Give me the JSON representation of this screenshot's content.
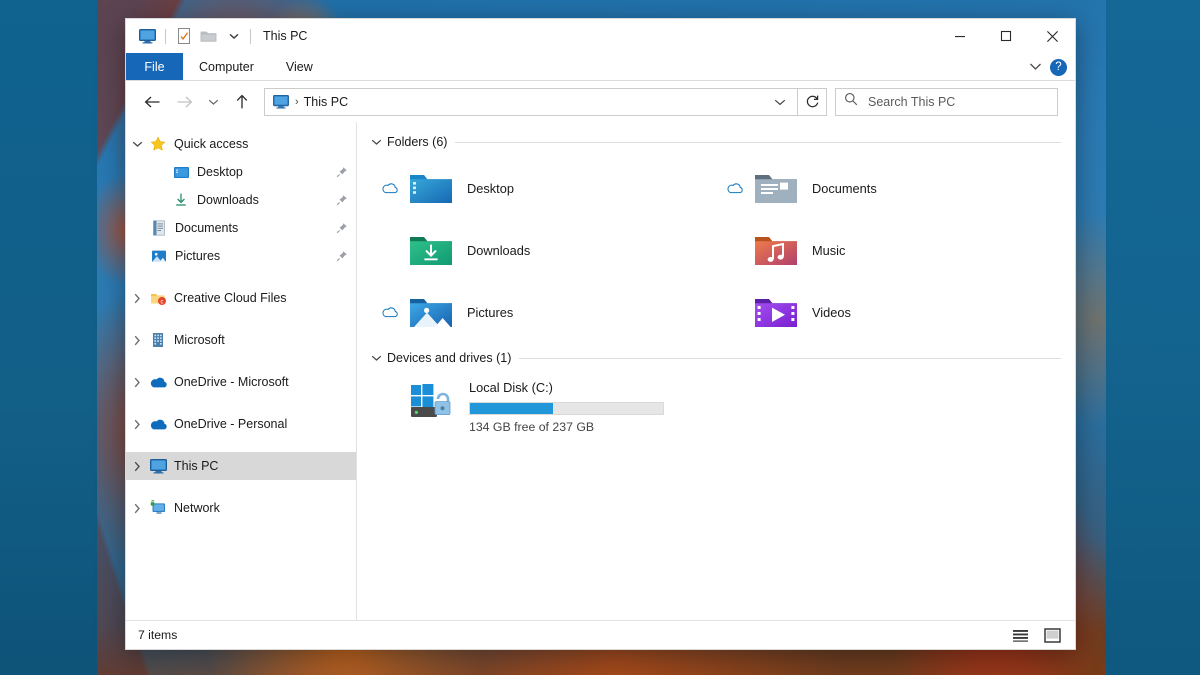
{
  "window": {
    "title": "This PC",
    "quick_access_toolbar": [
      {
        "name": "this-pc-icon",
        "label": "This PC"
      },
      {
        "name": "properties-icon",
        "label": "Properties"
      },
      {
        "name": "new-folder-icon",
        "label": "New folder"
      },
      {
        "name": "customize-dropdown-icon",
        "label": "Customize Quick Access Toolbar"
      }
    ],
    "controls": {
      "minimize": "─",
      "maximize": "☐",
      "close": "✕"
    }
  },
  "ribbon": {
    "tabs": [
      {
        "label": "File",
        "active": true
      },
      {
        "label": "Computer",
        "active": false
      },
      {
        "label": "View",
        "active": false
      }
    ],
    "expand_label": "Expand the Ribbon",
    "help_label": "?"
  },
  "navbar": {
    "back_label": "Back",
    "forward_label": "Forward",
    "recent_label": "Recent locations",
    "up_label": "Up to Desktop",
    "breadcrumb": {
      "icon": "this-pc-icon",
      "separator": "›",
      "text": "This PC"
    },
    "address_dropdown_label": "Previous locations",
    "refresh_label": "Refresh This PC",
    "search": {
      "placeholder": "Search This PC",
      "value": ""
    }
  },
  "sidebar": {
    "items": [
      {
        "label": "Quick access",
        "icon": "star-icon",
        "expanded": true,
        "chevron": "down",
        "indent": 0,
        "pinned": false,
        "selected": false
      },
      {
        "label": "Desktop",
        "icon": "desktop-folder-icon",
        "chevron": "none",
        "indent": 1,
        "pinned": true,
        "selected": false
      },
      {
        "label": "Downloads",
        "icon": "downloads-icon",
        "chevron": "none",
        "indent": 1,
        "pinned": true,
        "selected": false
      },
      {
        "label": "Documents",
        "icon": "documents-icon",
        "chevron": "none",
        "indent": 1,
        "pinned": true,
        "selected": false
      },
      {
        "label": "Pictures",
        "icon": "pictures-icon",
        "chevron": "none",
        "indent": 1,
        "pinned": true,
        "selected": false
      },
      {
        "label": "Creative Cloud Files",
        "icon": "creative-cloud-icon",
        "chevron": "right",
        "indent": 0,
        "pinned": false,
        "selected": false
      },
      {
        "label": "Microsoft",
        "icon": "building-icon",
        "chevron": "right",
        "indent": 0,
        "pinned": false,
        "selected": false
      },
      {
        "label": "OneDrive - Microsoft",
        "icon": "onedrive-icon",
        "chevron": "right",
        "indent": 0,
        "pinned": false,
        "selected": false
      },
      {
        "label": "OneDrive - Personal",
        "icon": "onedrive-icon",
        "chevron": "right",
        "indent": 0,
        "pinned": false,
        "selected": false
      },
      {
        "label": "This PC",
        "icon": "this-pc-icon",
        "chevron": "right",
        "indent": 0,
        "pinned": false,
        "selected": true
      },
      {
        "label": "Network",
        "icon": "network-icon",
        "chevron": "right",
        "indent": 0,
        "pinned": false,
        "selected": false
      }
    ]
  },
  "content": {
    "folders_group": {
      "title": "Folders (6)",
      "collapsed": false,
      "items": [
        {
          "label": "Desktop",
          "icon": "desktop-folder-icon",
          "cloud_status": "online-only"
        },
        {
          "label": "Documents",
          "icon": "documents-folder-icon",
          "cloud_status": "online-only"
        },
        {
          "label": "Downloads",
          "icon": "downloads-folder-icon",
          "cloud_status": "none"
        },
        {
          "label": "Music",
          "icon": "music-folder-icon",
          "cloud_status": "none"
        },
        {
          "label": "Pictures",
          "icon": "pictures-folder-icon",
          "cloud_status": "online-only"
        },
        {
          "label": "Videos",
          "icon": "videos-folder-icon",
          "cloud_status": "none"
        }
      ]
    },
    "devices_group": {
      "title": "Devices and drives (1)",
      "collapsed": false,
      "drives": [
        {
          "label": "Local Disk (C:)",
          "icon": "windows-drive-bitlocker-icon",
          "free_text": "134 GB free of 237 GB",
          "used_percent": 43,
          "bar_color": "#2196d9",
          "bar_track": "#e6e6e6"
        }
      ]
    }
  },
  "statusbar": {
    "item_count": "7 items",
    "views": [
      {
        "name": "details-view-button",
        "label": "Details view"
      },
      {
        "name": "large-icons-view-button",
        "label": "Large icons view"
      }
    ]
  },
  "colors": {
    "accent": "#1667b8",
    "selection": "#d8d8d8",
    "drive_bar": "#2196d9"
  }
}
